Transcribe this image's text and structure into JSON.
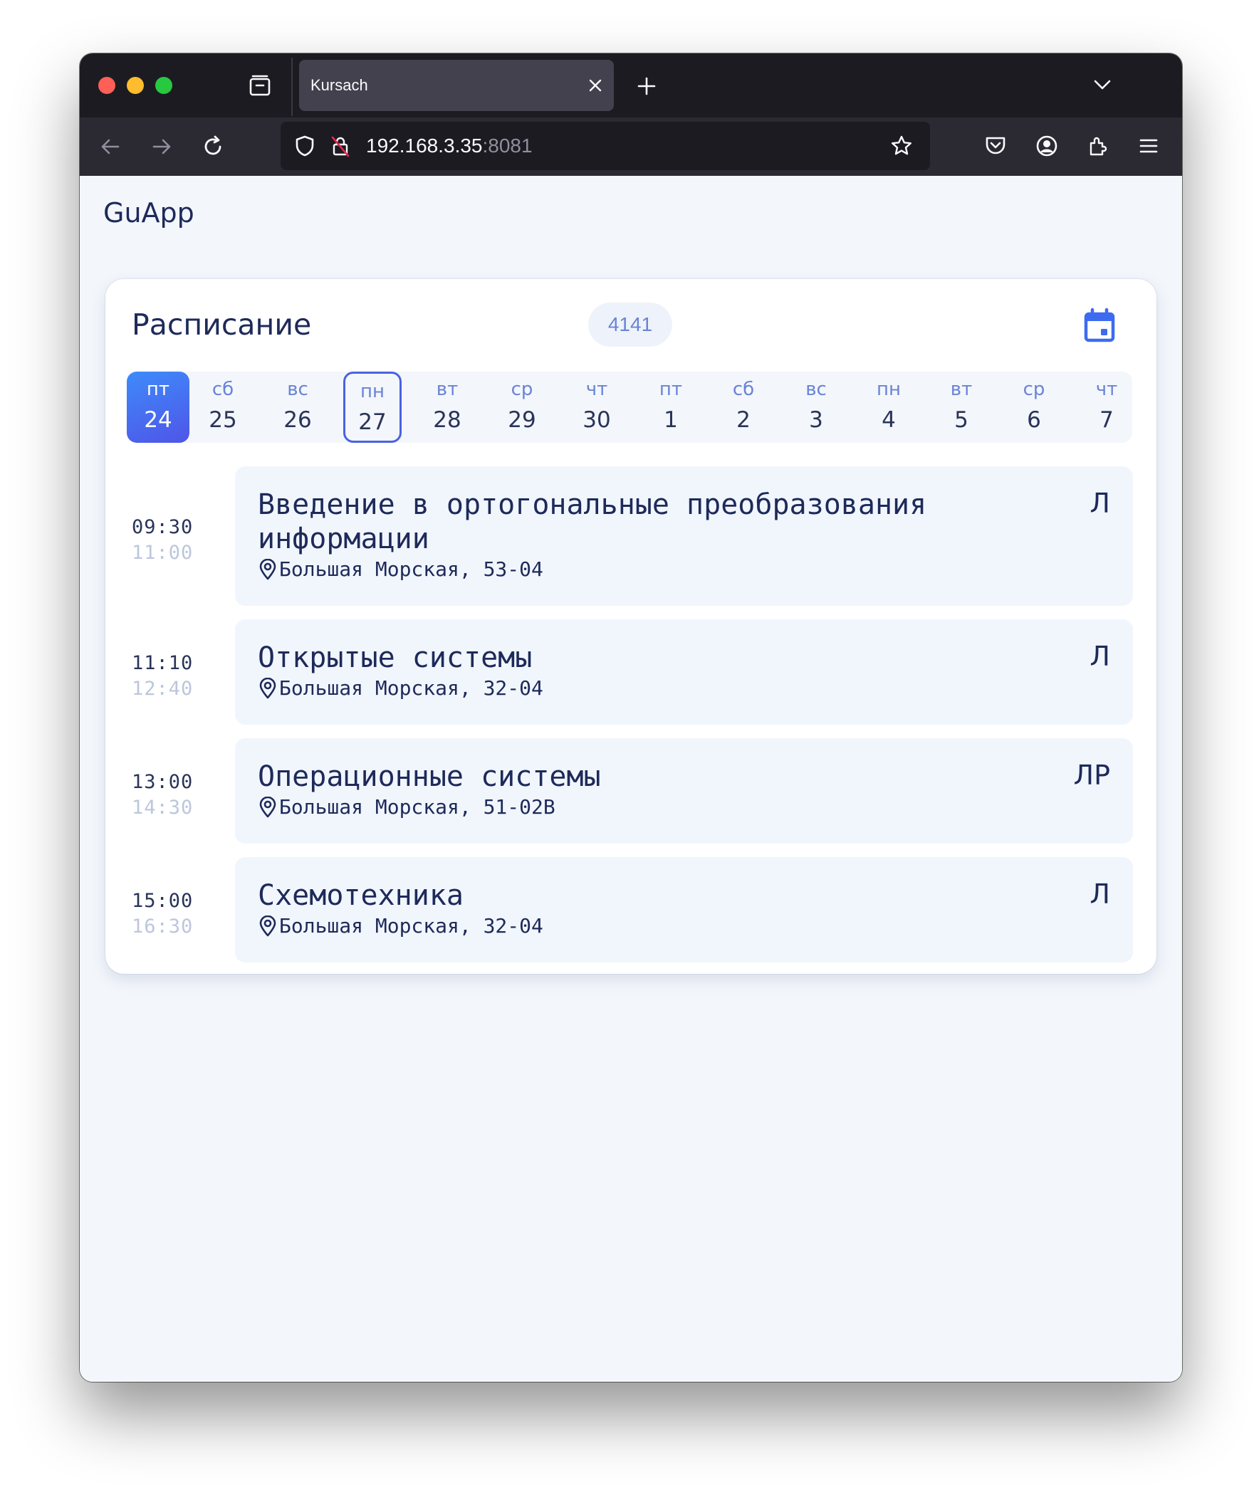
{
  "browser": {
    "tab_title": "Kursach",
    "url_host": "192.168.3.35",
    "url_port": ":8081"
  },
  "app": {
    "title": "GuApp"
  },
  "schedule": {
    "title": "Расписание",
    "group": "4141",
    "days": [
      {
        "dow": "пт",
        "num": "24"
      },
      {
        "dow": "сб",
        "num": "25"
      },
      {
        "dow": "вс",
        "num": "26"
      },
      {
        "dow": "пн",
        "num": "27"
      },
      {
        "dow": "вт",
        "num": "28"
      },
      {
        "dow": "ср",
        "num": "29"
      },
      {
        "dow": "чт",
        "num": "30"
      },
      {
        "dow": "пт",
        "num": "1"
      },
      {
        "dow": "сб",
        "num": "2"
      },
      {
        "dow": "вс",
        "num": "3"
      },
      {
        "dow": "пн",
        "num": "4"
      },
      {
        "dow": "вт",
        "num": "5"
      },
      {
        "dow": "ср",
        "num": "6"
      },
      {
        "dow": "чт",
        "num": "7"
      }
    ],
    "lessons": [
      {
        "start": "09:30",
        "end": "11:00",
        "name": "Введение в ортогональные преобразования информации",
        "room": "Большая Морская, 53-04",
        "type": "Л"
      },
      {
        "start": "11:10",
        "end": "12:40",
        "name": "Открытые системы",
        "room": "Большая Морская, 32-04",
        "type": "Л"
      },
      {
        "start": "13:00",
        "end": "14:30",
        "name": "Операционные системы",
        "room": "Большая Морская, 51-02В",
        "type": "ЛР"
      },
      {
        "start": "15:00",
        "end": "16:30",
        "name": "Схемотехника",
        "room": "Большая Морская, 32-04",
        "type": "Л"
      }
    ]
  }
}
